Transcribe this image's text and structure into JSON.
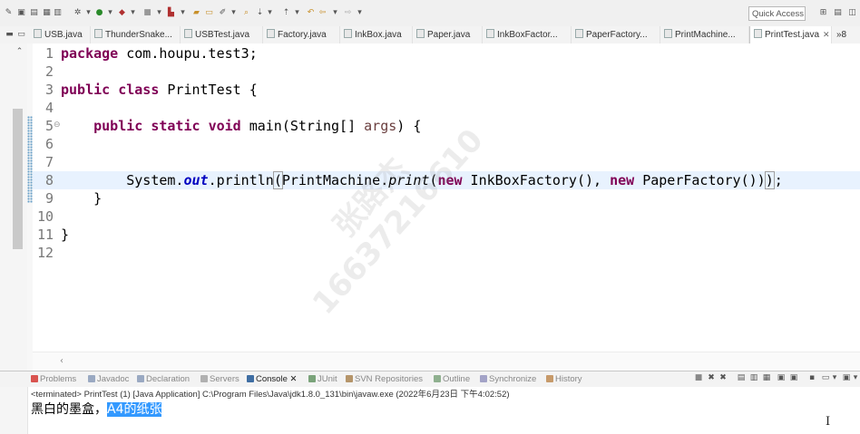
{
  "toolbar": {
    "quick_access": "Quick Access",
    "icons": [
      "pencil-icon",
      "save-icon",
      "print-icon",
      "new-icon",
      "debug-icon",
      "run-icon",
      "run-menu-icon",
      "stop-icon",
      "build-icon",
      "open-type-icon",
      "folder-icon",
      "search-icon",
      "pin-icon",
      "next-annotation-icon",
      "prev-annotation-icon",
      "back-icon",
      "forward-icon"
    ]
  },
  "editor_tabs": [
    {
      "label": "USB.java",
      "active": false
    },
    {
      "label": "ThunderSnake...",
      "active": false
    },
    {
      "label": "USBTest.java",
      "active": false
    },
    {
      "label": "Factory.java",
      "active": false
    },
    {
      "label": "InkBox.java",
      "active": false
    },
    {
      "label": "Paper.java",
      "active": false
    },
    {
      "label": "InkBoxFactor...",
      "active": false
    },
    {
      "label": "PaperFactory...",
      "active": false
    },
    {
      "label": "PrintMachine...",
      "active": false
    },
    {
      "label": "PrintTest.java",
      "active": true
    }
  ],
  "tabs_overflow": "»8",
  "code": {
    "line_numbers": [
      "1",
      "2",
      "3",
      "4",
      "5",
      "6",
      "7",
      "8",
      "9",
      "10",
      "11",
      "12"
    ],
    "l1_kw": "package",
    "l1_rest": " com.houpu.test3;",
    "l3_kw1": "public",
    "l3_kw2": "class",
    "l3_rest": " PrintTest {",
    "l5_indent": "    ",
    "l5_kw1": "public",
    "l5_kw2": "static",
    "l5_kw3": "void",
    "l5_rest1": " main(String[] ",
    "l5_param": "args",
    "l5_rest2": ") {",
    "l8_a": "        System.",
    "l8_out": "out",
    "l8_b": ".println",
    "l8_paren": "(",
    "l8_c": "PrintMachine.",
    "l8_print": "print",
    "l8_d": "(",
    "l8_new1": "new",
    "l8_e": " InkBoxFactory(), ",
    "l8_new2": "new",
    "l8_f": " PaperFactory())",
    "l8_lastparen": ")",
    "l8_semi": ";",
    "l9": "    }",
    "l11": "}",
    "fold_marker": "⊖"
  },
  "views": {
    "tabs": [
      {
        "label": "Problems",
        "color": "#d9534f"
      },
      {
        "label": "Javadoc",
        "color": "#9aa9c2"
      },
      {
        "label": "Declaration",
        "color": "#9aa9c2"
      },
      {
        "label": "Servers",
        "color": "#b0b0b0"
      },
      {
        "label": "Console",
        "color": "#3f6ea3",
        "active": true
      },
      {
        "label": "JUnit",
        "color": "#7aa37a"
      },
      {
        "label": "SVN Repositories",
        "color": "#b5956a"
      },
      {
        "label": "Outline",
        "color": "#8fb08f"
      },
      {
        "label": "Synchronize",
        "color": "#a3a3c7"
      },
      {
        "label": "History",
        "color": "#c79a6a"
      }
    ],
    "close_mark": "✕"
  },
  "console": {
    "status": "<terminated> PrintTest (1) [Java Application] C:\\Program Files\\Java\\jdk1.8.0_131\\bin\\javaw.exe (2022年6月23日 下午4:02:52)",
    "output_plain": "黑白的墨盒，",
    "output_selected": "A4的纸张"
  },
  "watermark": {
    "line1": "张路杰",
    "line2": "16637216610"
  }
}
